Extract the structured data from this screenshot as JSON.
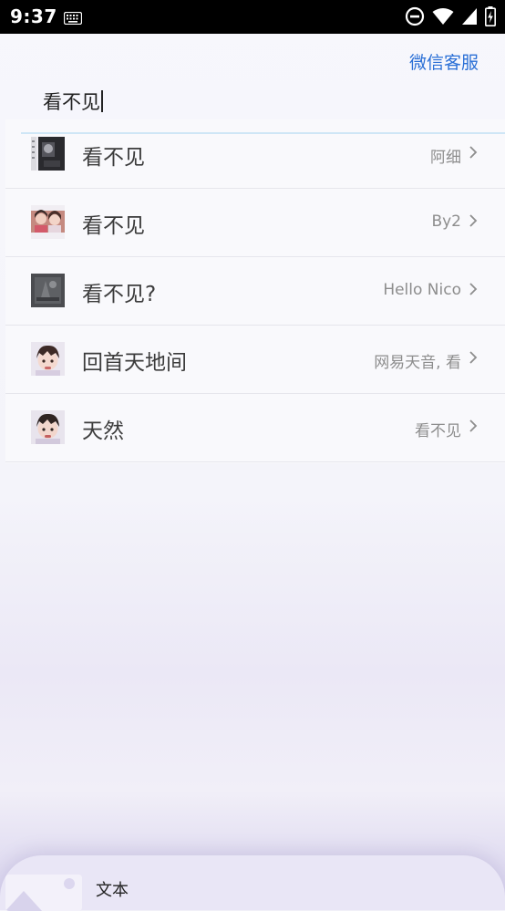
{
  "status_bar": {
    "time": "9:37",
    "icons": [
      "keyboard-icon",
      "do-not-disturb-icon",
      "wifi-icon",
      "signal-icon",
      "battery-charging-icon"
    ]
  },
  "header": {
    "service_link": "微信客服",
    "search_query": "看不见"
  },
  "results": [
    {
      "title": "看不见",
      "subtitle": "阿细",
      "thumb": "album-cover-dark-icon"
    },
    {
      "title": "看不见",
      "subtitle": "By2",
      "thumb": "album-cover-duo-icon"
    },
    {
      "title": "看不见?",
      "subtitle": "Hello Nico",
      "thumb": "album-cover-grey-icon"
    },
    {
      "title": "回首天地间",
      "subtitle": "网易天音, 看",
      "thumb": "anime-avatar-icon"
    },
    {
      "title": "天然",
      "subtitle": "看不见",
      "thumb": "anime-avatar-icon"
    }
  ],
  "bottom_sheet": {
    "label": "文本"
  },
  "colors": {
    "accent": "#2a6fd6",
    "title_text": "#3c3c3c",
    "subtitle_text": "#8d8d8d",
    "divider": "#e6e6ec",
    "status_bar_bg": "#000000"
  }
}
